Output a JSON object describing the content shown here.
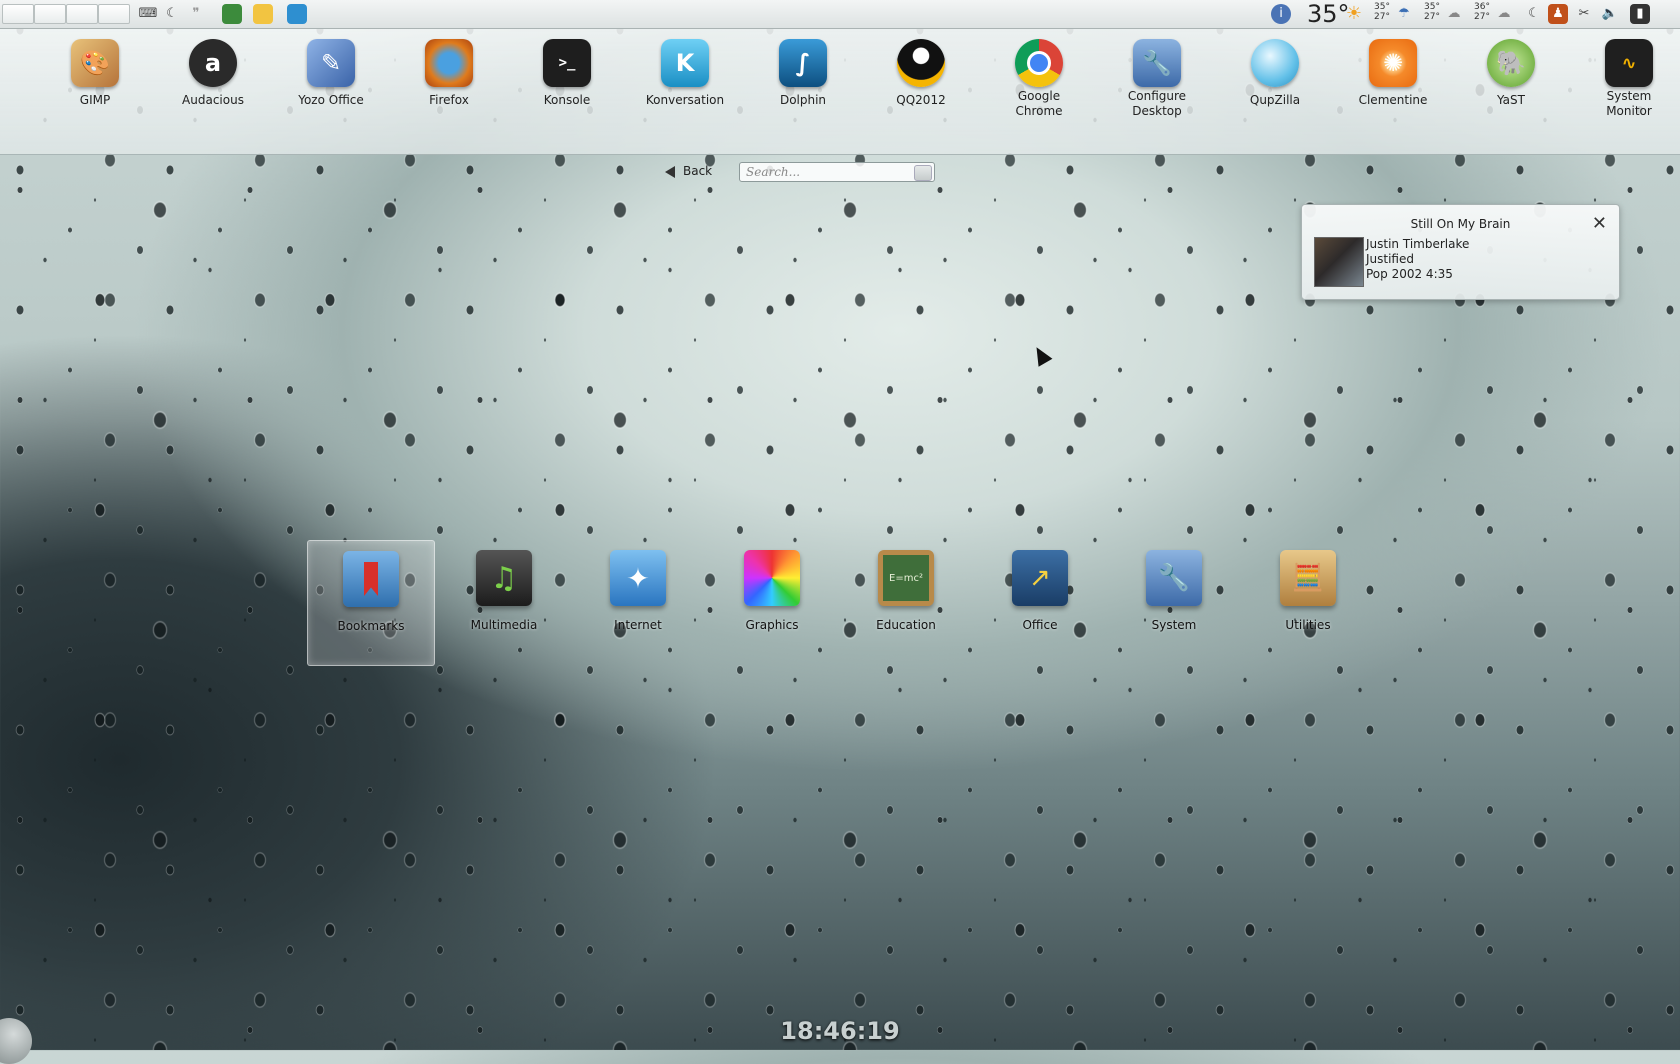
{
  "top_panel": {
    "temperature": "35°",
    "forecast": [
      {
        "high": "35°",
        "low": "27°"
      },
      {
        "high": "35°",
        "low": "27°"
      },
      {
        "high": "36°",
        "low": "27°"
      }
    ],
    "weather_icon": "partly-cloudy-icon",
    "tray_icons": [
      "info-icon",
      "moon-icon",
      "clipboard-icon",
      "battery-icon",
      "volume-icon",
      "scissors-icon",
      "device-icon"
    ]
  },
  "favorites": [
    {
      "label": "GIMP",
      "icon": "gimp-icon",
      "color": "#c9965a"
    },
    {
      "label": "Audacious",
      "icon": "audacious-icon",
      "color": "#2a2a2a"
    },
    {
      "label": "Yozo Office",
      "icon": "yozo-office-icon",
      "color": "#5b86c4"
    },
    {
      "label": "Firefox",
      "icon": "firefox-icon",
      "color": "#e07b1c"
    },
    {
      "label": "Konsole",
      "icon": "konsole-icon",
      "color": "#1e1e1e"
    },
    {
      "label": "Konversation",
      "icon": "konversation-icon",
      "color": "#2fa3d9"
    },
    {
      "label": "Dolphin",
      "icon": "dolphin-icon",
      "color": "#1a6ea8"
    },
    {
      "label": "QQ2012",
      "icon": "qq-penguin-icon",
      "color": "#1a1a1a"
    },
    {
      "label": "Google\nChrome",
      "icon": "chrome-icon",
      "color": "#3c8b3c"
    },
    {
      "label": "Configure\nDesktop",
      "icon": "configure-desktop-icon",
      "color": "#4a6e9e"
    },
    {
      "label": "QupZilla",
      "icon": "qupzilla-icon",
      "color": "#66c3e6"
    },
    {
      "label": "Clementine",
      "icon": "clementine-icon",
      "color": "#f0802a"
    },
    {
      "label": "YaST",
      "icon": "yast-icon",
      "color": "#73b23a"
    },
    {
      "label": "System\nMonitor",
      "icon": "system-monitor-icon",
      "color": "#2a2a2a"
    }
  ],
  "navigation": {
    "back_label": "Back",
    "search_placeholder": "Search..."
  },
  "notification": {
    "title": "Still On My Brain",
    "artist": "Justin Timberlake",
    "album": "Justified",
    "details": "Pop 2002 4:35"
  },
  "categories": [
    {
      "label": "Bookmarks",
      "icon": "bookmarks-folder-icon",
      "color": "#4d8fc9",
      "selected": true
    },
    {
      "label": "Multimedia",
      "icon": "multimedia-icon",
      "color": "#333333"
    },
    {
      "label": "Internet",
      "icon": "internet-icon",
      "color": "#3e8fd6"
    },
    {
      "label": "Graphics",
      "icon": "graphics-color-wheel-icon",
      "color": "#e05080"
    },
    {
      "label": "Education",
      "icon": "education-chalkboard-icon",
      "color": "#5a8a4a"
    },
    {
      "label": "Office",
      "icon": "office-chart-icon",
      "color": "#2e5c8a"
    },
    {
      "label": "System",
      "icon": "system-wrench-icon",
      "color": "#4a6e9e"
    },
    {
      "label": "Utilities",
      "icon": "utilities-calculator-icon",
      "color": "#c49a5a"
    }
  ],
  "clock": "18:46:19"
}
